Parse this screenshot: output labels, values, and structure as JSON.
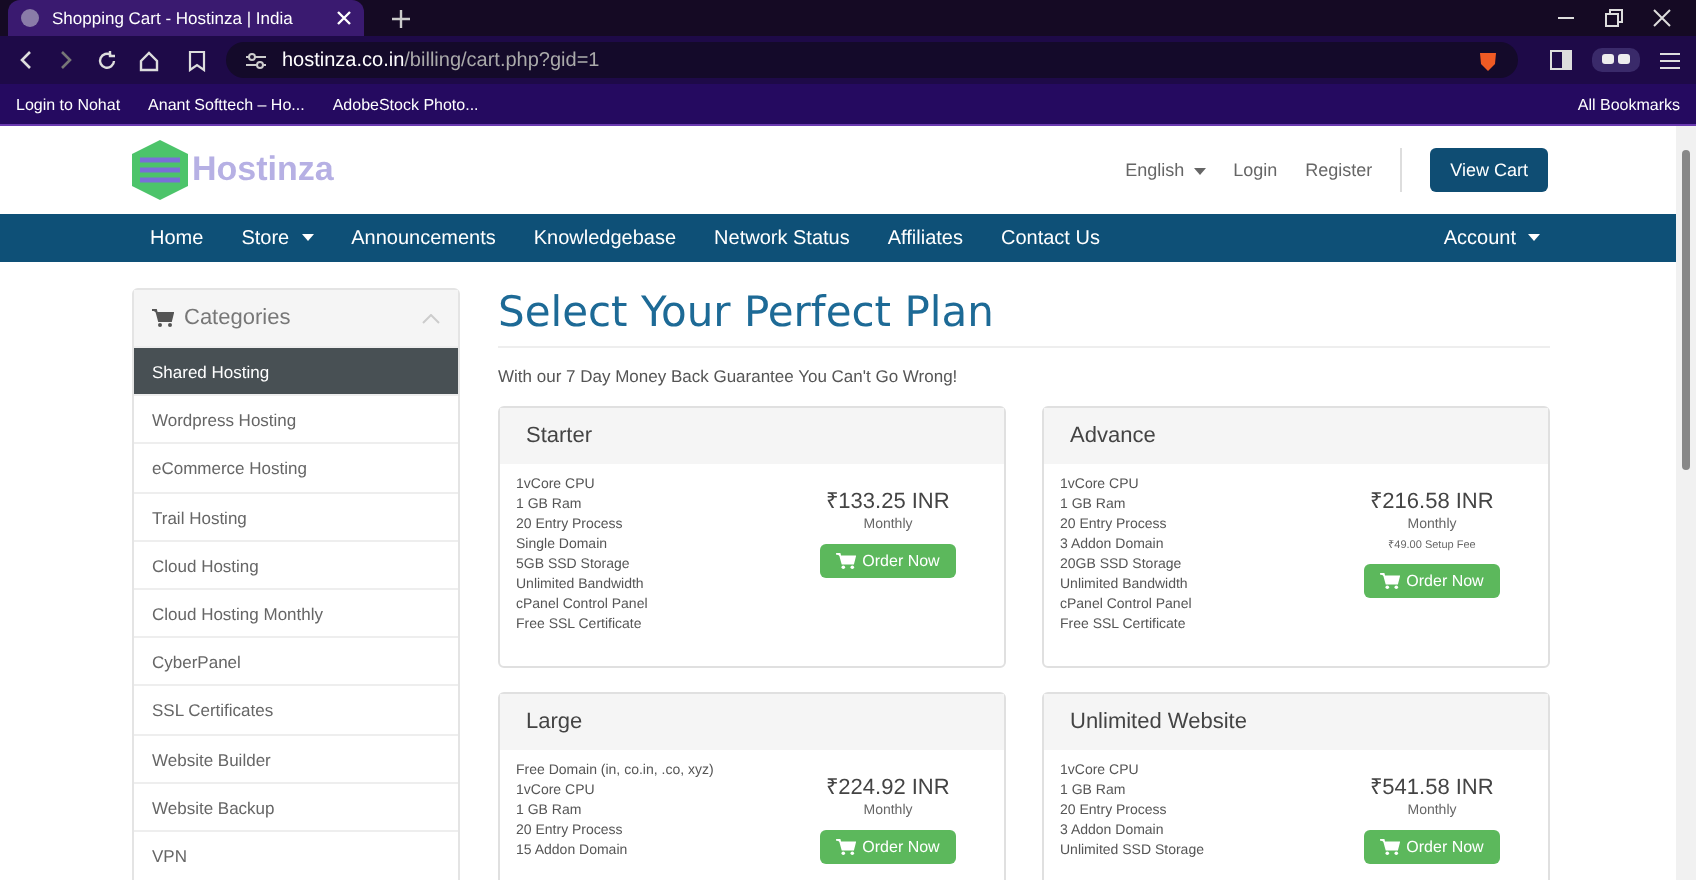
{
  "browser": {
    "tab_title": "Shopping Cart - Hostinza | India",
    "url_host": "hostinza.co.in",
    "url_path": "/billing/cart.php?gid=1",
    "bookmarks": [
      "Login to Nohat",
      "Anant Softtech – Ho...",
      "AdobeStock Photo..."
    ],
    "all_bookmarks": "All Bookmarks"
  },
  "header": {
    "logo": "Hostinza",
    "language": "English",
    "login": "Login",
    "register": "Register",
    "cart_button": "View Cart"
  },
  "nav": {
    "items": [
      {
        "label": "Home",
        "dropdown": false
      },
      {
        "label": "Store",
        "dropdown": true
      },
      {
        "label": "Announcements",
        "dropdown": false
      },
      {
        "label": "Knowledgebase",
        "dropdown": false
      },
      {
        "label": "Network Status",
        "dropdown": false
      },
      {
        "label": "Affiliates",
        "dropdown": false
      },
      {
        "label": "Contact Us",
        "dropdown": false
      }
    ],
    "account": "Account"
  },
  "sidebar": {
    "title": "Categories",
    "items": [
      {
        "label": "Shared Hosting",
        "selected": true
      },
      {
        "label": "Wordpress Hosting",
        "selected": false
      },
      {
        "label": "eCommerce Hosting",
        "selected": false
      },
      {
        "label": "Trail Hosting",
        "selected": false
      },
      {
        "label": "Cloud Hosting",
        "selected": false
      },
      {
        "label": "Cloud Hosting Monthly",
        "selected": false
      },
      {
        "label": "CyberPanel",
        "selected": false
      },
      {
        "label": "SSL Certificates",
        "selected": false
      },
      {
        "label": "Website Builder",
        "selected": false
      },
      {
        "label": "Website Backup",
        "selected": false
      },
      {
        "label": "VPN",
        "selected": false
      }
    ]
  },
  "page_title": "Select Your Perfect Plan",
  "tagline": "With our 7 Day Money Back Guarantee You Can't Go Wrong!",
  "plans": [
    {
      "name": "Starter",
      "features": [
        "1vCore CPU",
        "1 GB Ram",
        "20 Entry Process",
        "Single Domain",
        "5GB SSD Storage",
        "Unlimited Bandwidth",
        "cPanel Control Panel",
        "Free SSL Certificate"
      ],
      "price": "₹133.25 INR",
      "cycle": "Monthly",
      "order": "Order Now"
    },
    {
      "name": "Advance",
      "features": [
        "1vCore CPU",
        "1 GB Ram",
        "20 Entry Process",
        "3 Addon Domain",
        "20GB SSD Storage",
        "Unlimited Bandwidth",
        "cPanel Control Panel",
        "Free SSL Certificate"
      ],
      "price": "₹216.58 INR",
      "cycle": "Monthly",
      "setup_fee": "₹49.00 Setup Fee",
      "order": "Order Now"
    },
    {
      "name": "Large",
      "features": [
        "Free Domain (in, co.in, .co, xyz)",
        "1vCore CPU",
        "1 GB Ram",
        "20 Entry Process",
        "15 Addon Domain"
      ],
      "price": "₹224.92 INR",
      "cycle": "Monthly",
      "order": "Order Now"
    },
    {
      "name": "Unlimited Website",
      "features": [
        "1vCore CPU",
        "1 GB Ram",
        "20 Entry Process",
        "3 Addon Domain",
        "Unlimited SSD Storage"
      ],
      "price": "₹541.58 INR",
      "cycle": "Monthly",
      "order": "Order Now"
    }
  ]
}
